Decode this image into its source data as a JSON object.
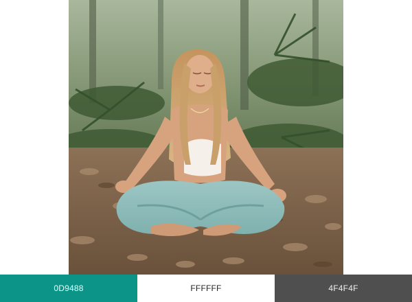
{
  "image": {
    "icon": "meditation-photo"
  },
  "palette": {
    "swatches": [
      {
        "label": "0D9488",
        "color": "#0D9488"
      },
      {
        "label": "FFFFFF",
        "color": "#FFFFFF"
      },
      {
        "label": "4F4F4F",
        "color": "#4F4F4F"
      }
    ]
  }
}
